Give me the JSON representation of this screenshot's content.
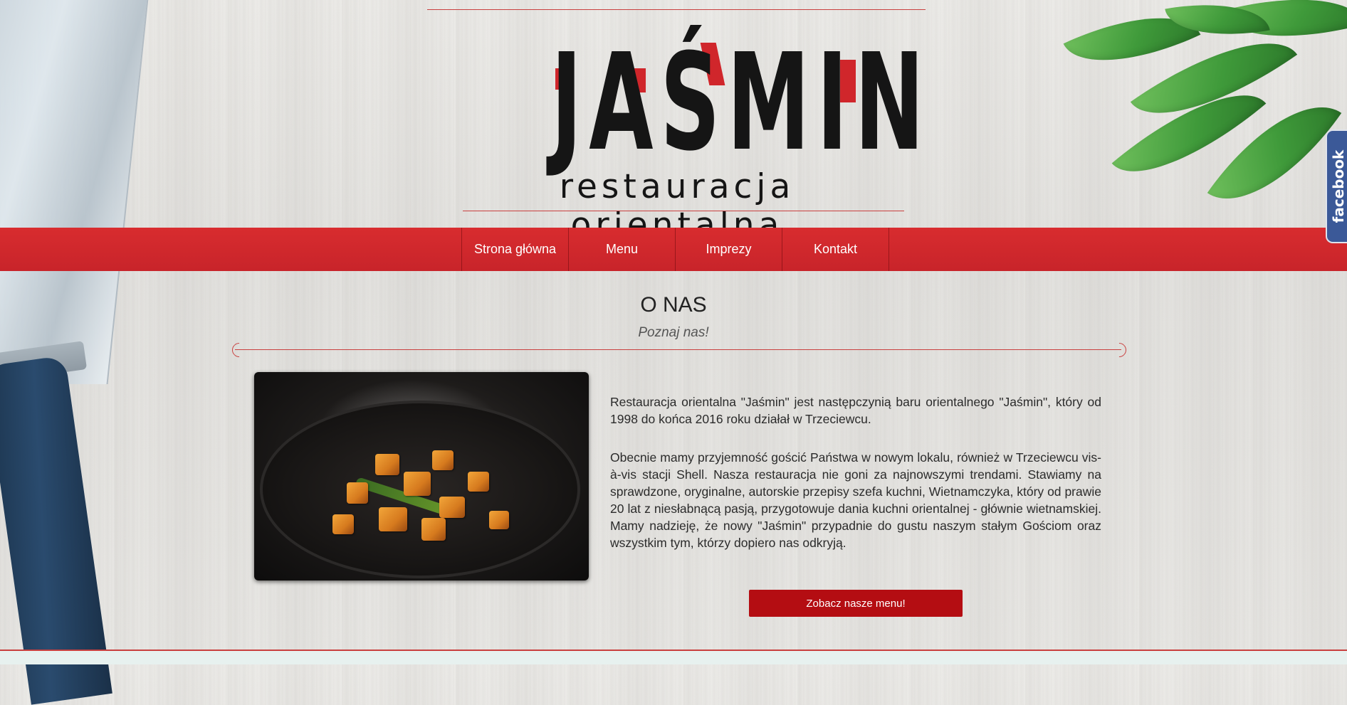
{
  "header": {
    "logo_title": "JAŚMIN",
    "logo_subtitle": "restauracja orientalna"
  },
  "nav": {
    "items": [
      {
        "label": "Strona główna"
      },
      {
        "label": "Menu"
      },
      {
        "label": "Imprezy"
      },
      {
        "label": "Kontakt"
      }
    ]
  },
  "social": {
    "facebook_label": "facebook",
    "facebook_color": "#3b5998"
  },
  "section": {
    "title": "O NAS",
    "subtitle": "Poznaj nas!",
    "paragraphs": [
      "Restauracja orientalna \"Jaśmin\" jest następczynią baru orientalnego \"Jaśmin\", który od 1998 do końca 2016 roku działał w Trzeciewcu.",
      "Obecnie mamy przyjemność gościć Państwa w nowym lokalu, również w Trzeciewcu vis-à-vis stacji Shell. Nasza restauracja nie goni za najnowszymi trendami. Stawiamy na sprawdzone, oryginalne, autorskie przepisy szefa kuchni, Wietnamczyka, który od prawie 20 lat z niesłabnącą pasją, przygotowuje dania kuchni orientalnej - głównie wietnamskiej. Mamy nadzieję, że nowy \"Jaśmin\" przypadnie do gustu naszym stałym Gościom oraz wszystkim tym, którzy dopiero nas odkryją."
    ],
    "cta_label": "Zobacz nasze menu!"
  },
  "colors": {
    "brand_red": "#c8242a",
    "button_red": "#b40d12",
    "text_dark": "#2b2b2b"
  }
}
